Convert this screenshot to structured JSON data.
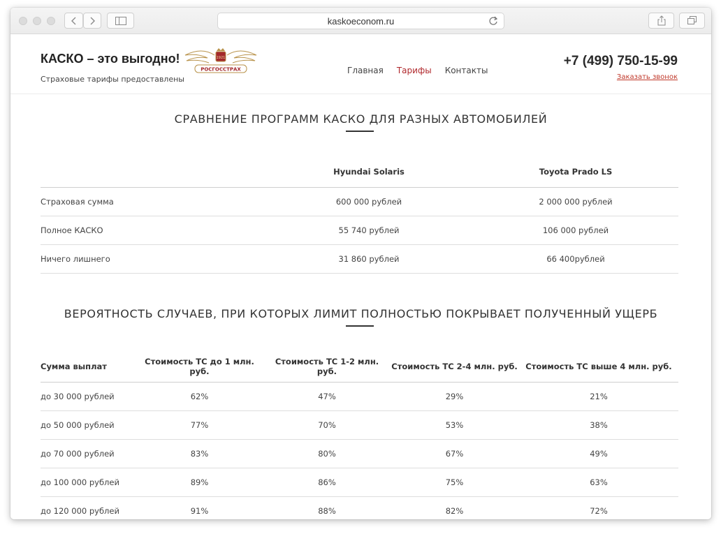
{
  "browser": {
    "url": "kaskoeconom.ru"
  },
  "header": {
    "title": "КАСКО – это выгодно!",
    "subtitle": "Страховые тарифы предоставлены",
    "logo_year": "1921",
    "logo_text": "РОСГОССТРАХ",
    "nav": [
      {
        "label": "Главная"
      },
      {
        "label": "Тарифы"
      },
      {
        "label": "Контакты"
      }
    ],
    "phone": "+7 (499) 750-15-99",
    "callback": "Заказать звонок"
  },
  "comparison": {
    "title": "СРАВНЕНИЕ ПРОГРАММ КАСКО ДЛЯ РАЗНЫХ АВТОМОБИЛЕЙ",
    "columns": [
      "",
      "Hyundai Solaris",
      "Toyota Prado LS"
    ],
    "rows": [
      [
        "Страховая сумма",
        "600 000 рублей",
        "2 000 000 рублей"
      ],
      [
        "Полное КАСКО",
        "55 740 рублей",
        "106 000 рублей"
      ],
      [
        "Ничего лишнего",
        "31 860 рублей",
        "66 400рублей"
      ]
    ]
  },
  "probability": {
    "title": "ВЕРОЯТНОСТЬ СЛУЧАЕВ, ПРИ КОТОРЫХ ЛИМИТ ПОЛНОСТЬЮ ПОКРЫВАЕТ ПОЛУЧЕННЫЙ УЩЕРБ",
    "columns": [
      "Сумма выплат",
      "Стоимость ТС до 1 млн. руб.",
      "Стоимость ТС 1-2 млн. руб.",
      "Стоимость ТС 2-4 млн. руб.",
      "Стоимость ТС выше 4 млн. руб."
    ],
    "rows": [
      [
        "до 30 000 рублей",
        "62%",
        "47%",
        "29%",
        "21%"
      ],
      [
        "до 50 000 рублей",
        "77%",
        "70%",
        "53%",
        "38%"
      ],
      [
        "до 70 000 рублей",
        "83%",
        "80%",
        "67%",
        "49%"
      ],
      [
        "до 100 000 рублей",
        "89%",
        "86%",
        "75%",
        "63%"
      ],
      [
        "до 120 000 рублей",
        "91%",
        "88%",
        "82%",
        "72%"
      ]
    ]
  }
}
